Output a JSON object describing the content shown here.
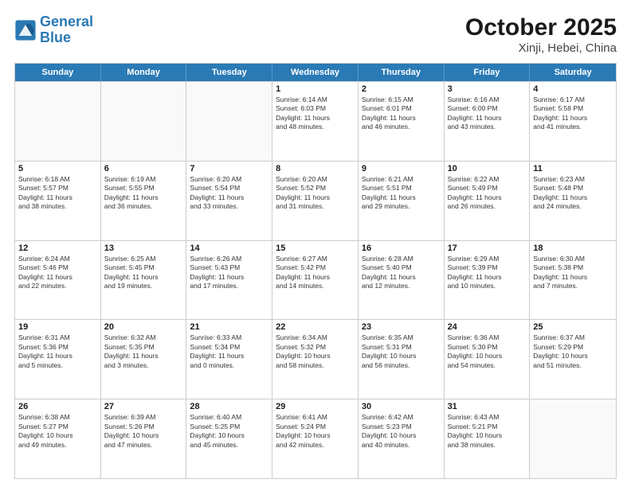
{
  "header": {
    "logo_line1": "General",
    "logo_line2": "Blue",
    "main_title": "October 2025",
    "sub_title": "Xinji, Hebei, China"
  },
  "days_of_week": [
    "Sunday",
    "Monday",
    "Tuesday",
    "Wednesday",
    "Thursday",
    "Friday",
    "Saturday"
  ],
  "rows": [
    [
      {
        "day": "",
        "info": "",
        "empty": true
      },
      {
        "day": "",
        "info": "",
        "empty": true
      },
      {
        "day": "",
        "info": "",
        "empty": true
      },
      {
        "day": "1",
        "info": "Sunrise: 6:14 AM\nSunset: 6:03 PM\nDaylight: 11 hours\nand 48 minutes."
      },
      {
        "day": "2",
        "info": "Sunrise: 6:15 AM\nSunset: 6:01 PM\nDaylight: 11 hours\nand 46 minutes."
      },
      {
        "day": "3",
        "info": "Sunrise: 6:16 AM\nSunset: 6:00 PM\nDaylight: 11 hours\nand 43 minutes."
      },
      {
        "day": "4",
        "info": "Sunrise: 6:17 AM\nSunset: 5:58 PM\nDaylight: 11 hours\nand 41 minutes."
      }
    ],
    [
      {
        "day": "5",
        "info": "Sunrise: 6:18 AM\nSunset: 5:57 PM\nDaylight: 11 hours\nand 38 minutes."
      },
      {
        "day": "6",
        "info": "Sunrise: 6:19 AM\nSunset: 5:55 PM\nDaylight: 11 hours\nand 36 minutes."
      },
      {
        "day": "7",
        "info": "Sunrise: 6:20 AM\nSunset: 5:54 PM\nDaylight: 11 hours\nand 33 minutes."
      },
      {
        "day": "8",
        "info": "Sunrise: 6:20 AM\nSunset: 5:52 PM\nDaylight: 11 hours\nand 31 minutes."
      },
      {
        "day": "9",
        "info": "Sunrise: 6:21 AM\nSunset: 5:51 PM\nDaylight: 11 hours\nand 29 minutes."
      },
      {
        "day": "10",
        "info": "Sunrise: 6:22 AM\nSunset: 5:49 PM\nDaylight: 11 hours\nand 26 minutes."
      },
      {
        "day": "11",
        "info": "Sunrise: 6:23 AM\nSunset: 5:48 PM\nDaylight: 11 hours\nand 24 minutes."
      }
    ],
    [
      {
        "day": "12",
        "info": "Sunrise: 6:24 AM\nSunset: 5:46 PM\nDaylight: 11 hours\nand 22 minutes."
      },
      {
        "day": "13",
        "info": "Sunrise: 6:25 AM\nSunset: 5:45 PM\nDaylight: 11 hours\nand 19 minutes."
      },
      {
        "day": "14",
        "info": "Sunrise: 6:26 AM\nSunset: 5:43 PM\nDaylight: 11 hours\nand 17 minutes."
      },
      {
        "day": "15",
        "info": "Sunrise: 6:27 AM\nSunset: 5:42 PM\nDaylight: 11 hours\nand 14 minutes."
      },
      {
        "day": "16",
        "info": "Sunrise: 6:28 AM\nSunset: 5:40 PM\nDaylight: 11 hours\nand 12 minutes."
      },
      {
        "day": "17",
        "info": "Sunrise: 6:29 AM\nSunset: 5:39 PM\nDaylight: 11 hours\nand 10 minutes."
      },
      {
        "day": "18",
        "info": "Sunrise: 6:30 AM\nSunset: 5:38 PM\nDaylight: 11 hours\nand 7 minutes."
      }
    ],
    [
      {
        "day": "19",
        "info": "Sunrise: 6:31 AM\nSunset: 5:36 PM\nDaylight: 11 hours\nand 5 minutes."
      },
      {
        "day": "20",
        "info": "Sunrise: 6:32 AM\nSunset: 5:35 PM\nDaylight: 11 hours\nand 3 minutes."
      },
      {
        "day": "21",
        "info": "Sunrise: 6:33 AM\nSunset: 5:34 PM\nDaylight: 11 hours\nand 0 minutes."
      },
      {
        "day": "22",
        "info": "Sunrise: 6:34 AM\nSunset: 5:32 PM\nDaylight: 10 hours\nand 58 minutes."
      },
      {
        "day": "23",
        "info": "Sunrise: 6:35 AM\nSunset: 5:31 PM\nDaylight: 10 hours\nand 56 minutes."
      },
      {
        "day": "24",
        "info": "Sunrise: 6:36 AM\nSunset: 5:30 PM\nDaylight: 10 hours\nand 54 minutes."
      },
      {
        "day": "25",
        "info": "Sunrise: 6:37 AM\nSunset: 5:29 PM\nDaylight: 10 hours\nand 51 minutes."
      }
    ],
    [
      {
        "day": "26",
        "info": "Sunrise: 6:38 AM\nSunset: 5:27 PM\nDaylight: 10 hours\nand 49 minutes."
      },
      {
        "day": "27",
        "info": "Sunrise: 6:39 AM\nSunset: 5:26 PM\nDaylight: 10 hours\nand 47 minutes."
      },
      {
        "day": "28",
        "info": "Sunrise: 6:40 AM\nSunset: 5:25 PM\nDaylight: 10 hours\nand 45 minutes."
      },
      {
        "day": "29",
        "info": "Sunrise: 6:41 AM\nSunset: 5:24 PM\nDaylight: 10 hours\nand 42 minutes."
      },
      {
        "day": "30",
        "info": "Sunrise: 6:42 AM\nSunset: 5:23 PM\nDaylight: 10 hours\nand 40 minutes."
      },
      {
        "day": "31",
        "info": "Sunrise: 6:43 AM\nSunset: 5:21 PM\nDaylight: 10 hours\nand 38 minutes."
      },
      {
        "day": "",
        "info": "",
        "empty": true
      }
    ]
  ]
}
